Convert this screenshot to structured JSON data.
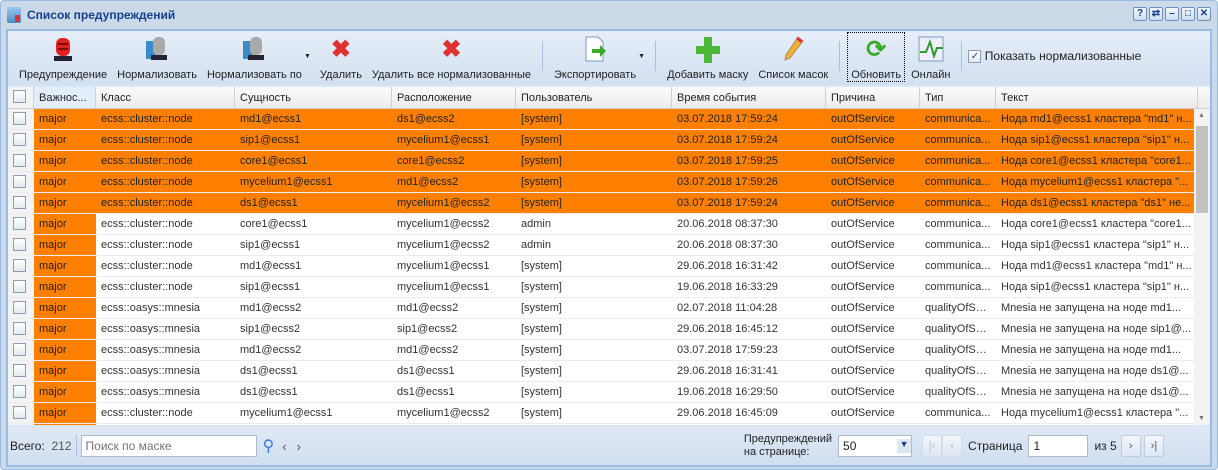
{
  "window": {
    "title": "Список предупреждений",
    "tools": [
      "?",
      "⇄",
      "–",
      "□",
      "✕"
    ]
  },
  "toolbar": {
    "alarm": "Предупреждение",
    "normalize": "Нормализовать",
    "normalize_by": "Нормализовать по",
    "delete": "Удалить",
    "delete_all_normalized": "Удалить все нормализованные",
    "export": "Экспортировать",
    "add_mask": "Добавить маску",
    "mask_list": "Список масок",
    "refresh": "Обновить",
    "online": "Онлайн",
    "show_normalized": "Показать нормализованные",
    "show_normalized_checked": true
  },
  "columns": [
    "Важнос...",
    "Класс",
    "Сущность",
    "Расположение",
    "Пользователь",
    "Время события",
    "Причина",
    "Тип",
    "Текст"
  ],
  "rows": [
    {
      "hl": true,
      "c": [
        "major",
        "ecss::cluster::node",
        "md1@ecss1",
        "ds1@ecss2",
        "[system]",
        "03.07.2018 17:59:24",
        "outOfService",
        "communica...",
        "Нода md1@ecss1 кластера \"md1\" н..."
      ]
    },
    {
      "hl": true,
      "c": [
        "major",
        "ecss::cluster::node",
        "sip1@ecss1",
        "mycelium1@ecss1",
        "[system]",
        "03.07.2018 17:59:24",
        "outOfService",
        "communica...",
        "Нода sip1@ecss1 кластера \"sip1\" н..."
      ]
    },
    {
      "hl": true,
      "c": [
        "major",
        "ecss::cluster::node",
        "core1@ecss1",
        "core1@ecss2",
        "[system]",
        "03.07.2018 17:59:25",
        "outOfService",
        "communica...",
        "Нода core1@ecss1 кластера \"core1..."
      ]
    },
    {
      "hl": true,
      "c": [
        "major",
        "ecss::cluster::node",
        "mycelium1@ecss1",
        "md1@ecss2",
        "[system]",
        "03.07.2018 17:59:26",
        "outOfService",
        "communica...",
        "Нода mycelium1@ecss1 кластера \"..."
      ]
    },
    {
      "hl": true,
      "c": [
        "major",
        "ecss::cluster::node",
        "ds1@ecss1",
        "mycelium1@ecss2",
        "[system]",
        "03.07.2018 17:59:24",
        "outOfService",
        "communica...",
        "Нода ds1@ecss1 кластера \"ds1\" не..."
      ]
    },
    {
      "hl": false,
      "c": [
        "major",
        "ecss::cluster::node",
        "core1@ecss1",
        "mycelium1@ecss2",
        "admin",
        "20.06.2018 08:37:30",
        "outOfService",
        "communica...",
        "Нода core1@ecss1 кластера \"core1..."
      ]
    },
    {
      "hl": false,
      "c": [
        "major",
        "ecss::cluster::node",
        "sip1@ecss1",
        "mycelium1@ecss2",
        "admin",
        "20.06.2018 08:37:30",
        "outOfService",
        "communica...",
        "Нода sip1@ecss1 кластера \"sip1\" н..."
      ]
    },
    {
      "hl": false,
      "c": [
        "major",
        "ecss::cluster::node",
        "md1@ecss1",
        "mycelium1@ecss1",
        "[system]",
        "29.06.2018 16:31:42",
        "outOfService",
        "communica...",
        "Нода md1@ecss1 кластера \"md1\" н..."
      ]
    },
    {
      "hl": false,
      "c": [
        "major",
        "ecss::cluster::node",
        "sip1@ecss1",
        "mycelium1@ecss1",
        "[system]",
        "19.06.2018 16:33:29",
        "outOfService",
        "communica...",
        "Нода sip1@ecss1 кластера \"sip1\" н..."
      ]
    },
    {
      "hl": false,
      "c": [
        "major",
        "ecss::oasys::mnesia",
        "md1@ecss2",
        "md1@ecss2",
        "[system]",
        "02.07.2018 11:04:28",
        "outOfService",
        "qualityOfSe...",
        "Mnesia не запущена на ноде md1..."
      ]
    },
    {
      "hl": false,
      "c": [
        "major",
        "ecss::oasys::mnesia",
        "sip1@ecss2",
        "sip1@ecss2",
        "[system]",
        "29.06.2018 16:45:12",
        "outOfService",
        "qualityOfSe...",
        "Mnesia не запущена на ноде sip1@..."
      ]
    },
    {
      "hl": false,
      "c": [
        "major",
        "ecss::oasys::mnesia",
        "md1@ecss2",
        "md1@ecss2",
        "[system]",
        "03.07.2018 17:59:23",
        "outOfService",
        "qualityOfSe...",
        "Mnesia не запущена на ноде md1..."
      ]
    },
    {
      "hl": false,
      "c": [
        "major",
        "ecss::oasys::mnesia",
        "ds1@ecss1",
        "ds1@ecss1",
        "[system]",
        "29.06.2018 16:31:41",
        "outOfService",
        "qualityOfSe...",
        "Mnesia не запущена на ноде ds1@..."
      ]
    },
    {
      "hl": false,
      "c": [
        "major",
        "ecss::oasys::mnesia",
        "ds1@ecss1",
        "ds1@ecss1",
        "[system]",
        "19.06.2018 16:29:50",
        "outOfService",
        "qualityOfSe...",
        "Mnesia не запущена на ноде ds1@..."
      ]
    },
    {
      "hl": false,
      "c": [
        "major",
        "ecss::cluster::node",
        "mycelium1@ecss1",
        "mycelium1@ecss2",
        "[system]",
        "29.06.2018 16:45:09",
        "outOfService",
        "communica...",
        "Нода mycelium1@ecss1 кластера \"..."
      ]
    },
    {
      "hl": false,
      "c": [
        "",
        "",
        "",
        "",
        "",
        "",
        "",
        "",
        ""
      ]
    }
  ],
  "footer": {
    "total_label": "Всего:",
    "total": "212",
    "search_placeholder": "Поиск по маске",
    "per_page_label1": "Предупреждений",
    "per_page_label2": "на странице:",
    "per_page": "50",
    "page_label": "Страница",
    "page": "1",
    "of_pages": "из 5"
  },
  "colors": {
    "highlight": "#ff8000"
  }
}
